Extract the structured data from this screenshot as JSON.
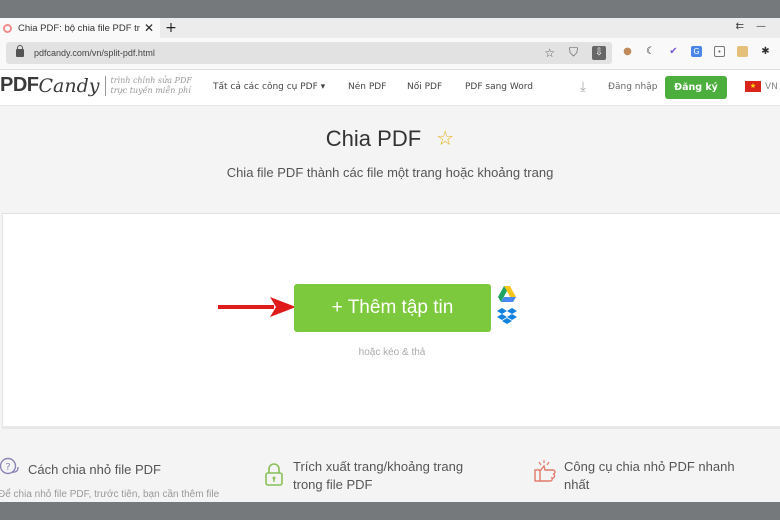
{
  "browser": {
    "tab": {
      "title": "Chia PDF: bộ chia file PDF trực",
      "close_label": "✕"
    },
    "new_tab_label": "+",
    "url": "pdfcandy.com/vn/split-pdf.html",
    "window_controls": [
      "⇇",
      "—"
    ],
    "url_icons": [
      "star-icon",
      "shield-icon",
      "download-icon"
    ],
    "extensions": [
      "cookie-ext-icon",
      "moon-ext-icon",
      "check-ext-icon",
      "translate-ext-icon",
      "chat-ext-icon",
      "face-ext-icon",
      "puzzle-ext-icon"
    ]
  },
  "site": {
    "logo": {
      "pdf": "PDF",
      "candy": "Candy",
      "tagline_1": "trình chỉnh sửa PDF",
      "tagline_2": "trực tuyến miễn phí"
    },
    "menu": {
      "all_tools": "Tất cả các công cụ PDF ▾",
      "compress": "Nén PDF",
      "merge": "Nối PDF",
      "to_word": "PDF sang Word"
    },
    "login": "Đăng nhập",
    "signup": "Đăng ký",
    "lang": "VN"
  },
  "main": {
    "title": "Chia PDF",
    "subtitle": "Chia file PDF thành các file một trang hoặc khoảng trang",
    "add_button": "+ Thêm tập tin",
    "drag_hint": "hoặc kéo & thả",
    "colors": {
      "accent_green": "#7dc93d",
      "signup_green": "#4cae3c",
      "arrow_red": "#e01b1b",
      "star_gold": "#e6b422"
    }
  },
  "features": [
    {
      "icon": "question-chat-icon",
      "title": "Cách chia nhỏ file PDF",
      "desc": "Để chia nhỏ file PDF, trước tiên, bạn cần thêm file"
    },
    {
      "icon": "lock-icon",
      "title_1": "Trích xuất trang/khoảng trang",
      "title_2": "trong file PDF"
    },
    {
      "icon": "thumbs-up-icon",
      "title_1": "Công cụ chia nhỏ PDF nhanh",
      "title_2": "nhất"
    }
  ]
}
